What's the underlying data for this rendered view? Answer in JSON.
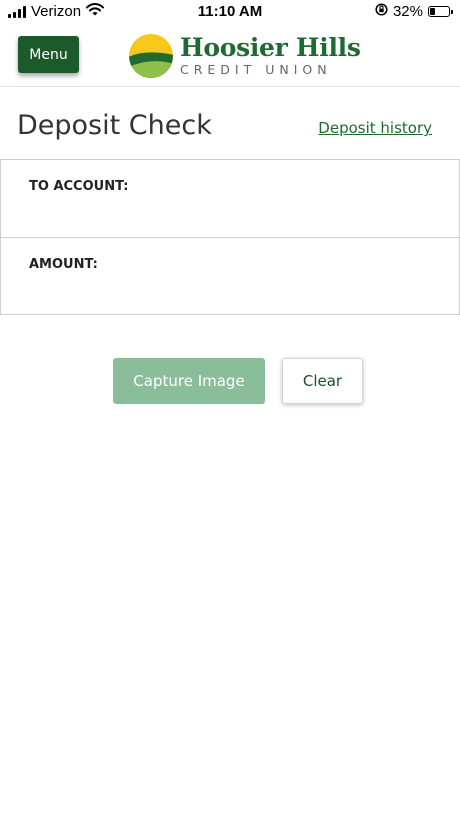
{
  "status_bar": {
    "carrier": "Verizon",
    "time": "11:10 AM",
    "battery_percent": "32%",
    "battery_level": 0.32,
    "icons": [
      "signal-icon",
      "wifi-icon",
      "orientation-lock-icon",
      "battery-icon"
    ]
  },
  "header": {
    "menu_label": "Menu",
    "logo_name": "Hoosier Hills",
    "logo_subtitle": "CREDIT UNION",
    "logo_colors": {
      "sun": "#f5c91b",
      "hill_dark": "#1f6a30",
      "hill_light": "#8cc04b"
    }
  },
  "page": {
    "title": "Deposit Check",
    "history_link": "Deposit history"
  },
  "form": {
    "to_account_label": "TO ACCOUNT:",
    "amount_label": "AMOUNT:",
    "capture_label": "Capture Image",
    "clear_label": "Clear"
  },
  "colors": {
    "brand_green": "#1d5a2a",
    "capture_disabled": "#8abd9a",
    "link_green": "#1f6a30"
  }
}
